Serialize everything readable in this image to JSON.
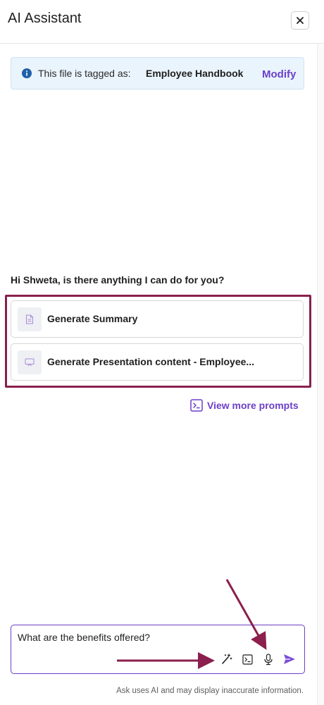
{
  "header": {
    "title": "AI Assistant",
    "close_icon": "close-icon"
  },
  "info_banner": {
    "icon": "info-icon",
    "prefix": "This file is tagged as:",
    "tag": "Employee Handbook",
    "action_label": "Modify"
  },
  "greeting": "Hi Shweta, is there anything I can do for you?",
  "prompts": [
    {
      "icon": "document-icon",
      "label": "Generate Summary"
    },
    {
      "icon": "presentation-icon",
      "label": "Generate Presentation content - Employee..."
    }
  ],
  "view_more": {
    "icon": "prompt-terminal-icon",
    "label": "View more prompts"
  },
  "composer": {
    "value": "What are the benefits offered?",
    "tools": [
      "magic-wand-icon",
      "prompt-terminal-icon",
      "microphone-icon",
      "send-icon"
    ]
  },
  "disclaimer": "Ask uses AI and may display inaccurate information.",
  "colors": {
    "accent": "#6b3fc8",
    "annotation": "#8b1f4d",
    "info_bg": "#eaf4fc",
    "info_icon": "#1f5fa8"
  }
}
